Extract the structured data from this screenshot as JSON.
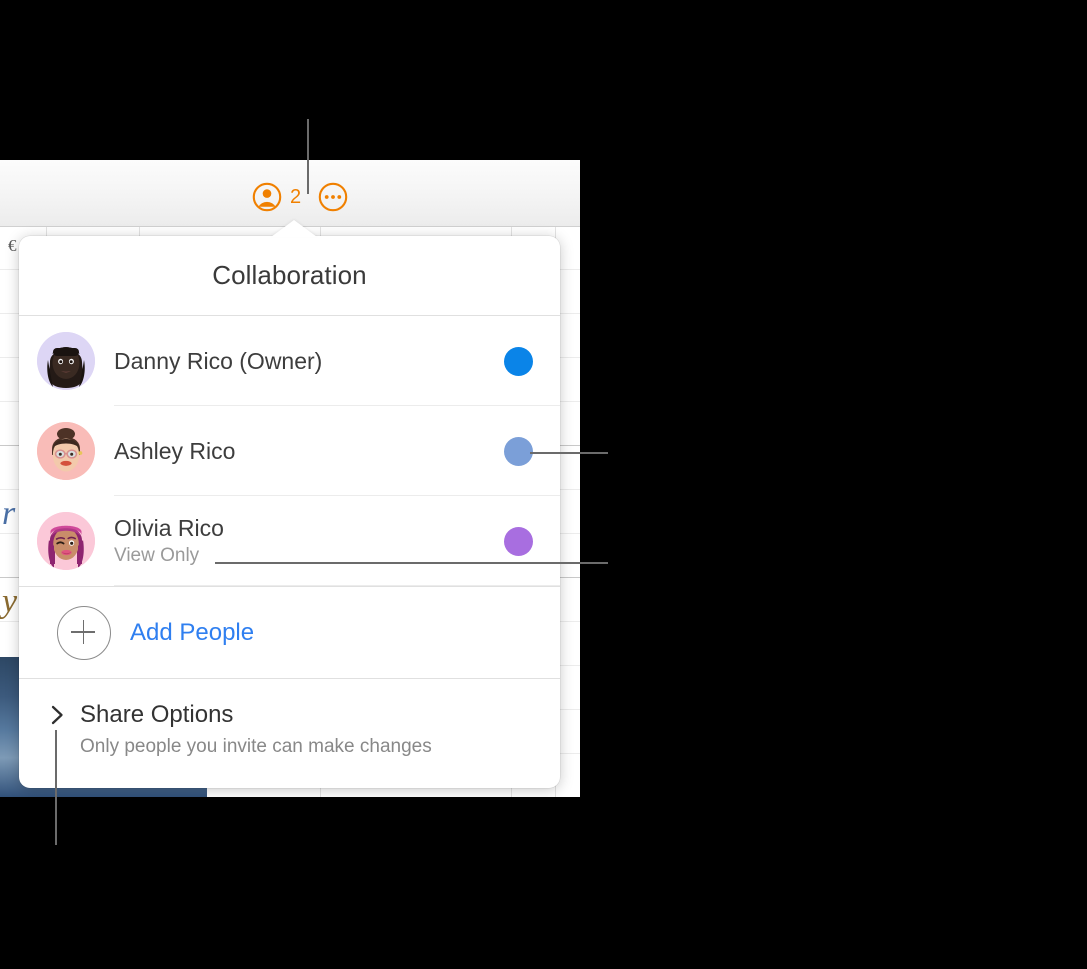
{
  "toolbar": {
    "collaborate_icon": "person-circle-icon",
    "participant_count": "2",
    "more_icon": "ellipsis-circle-icon"
  },
  "popover": {
    "title": "Collaboration",
    "participants": [
      {
        "name": "Danny Rico (Owner)",
        "sub": "",
        "dot_color": "#0a84e8",
        "avatar": "memoji-danny",
        "avatar_bg": "#ddd6f5"
      },
      {
        "name": "Ashley Rico",
        "sub": "",
        "dot_color": "#7b9fd8",
        "avatar": "memoji-ashley",
        "avatar_bg": "#f9bcb8"
      },
      {
        "name": "Olivia Rico",
        "sub": "View Only",
        "dot_color": "#a86ee0",
        "avatar": "memoji-olivia",
        "avatar_bg": "#fbc8d8"
      }
    ],
    "add_people": {
      "label": "Add People",
      "icon": "plus-circle-icon",
      "color": "#2f7ff0"
    },
    "share_options": {
      "title": "Share Options",
      "description": "Only people you invite can make changes",
      "icon": "chevron-right-icon"
    }
  },
  "background": {
    "cell_glyph_left": "€",
    "cell_glyph_script_a": "r",
    "cell_glyph_script_b": "y"
  },
  "colors": {
    "accent_orange": "#f08000",
    "link_blue": "#2f7ff0",
    "callout_gray": "#6b6b6b",
    "selected_cell_orange": "#d98615"
  }
}
